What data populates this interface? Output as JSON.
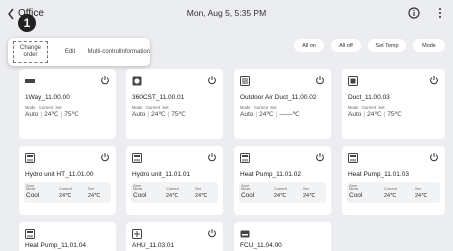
{
  "header": {
    "title": "Office",
    "datetime": "Mon, Aug 5, 5:35 PM",
    "badge": "1"
  },
  "menu": {
    "change_order": "Change order",
    "edit": "Edit",
    "multi_control": "Multi-control",
    "information": "Information"
  },
  "actions": {
    "all_on": "All on",
    "all_off": "All off",
    "set_temp": "Set Temp",
    "mode": "Mode"
  },
  "labels": {
    "mode": "Mode",
    "current": "Current",
    "set": "Set",
    "zone": "Zone"
  },
  "devices": [
    {
      "name": "1Way_11.00.00",
      "icon": "ceiling-cassette-1way-icon",
      "mode": "Auto",
      "current": "24℃",
      "set": "75℃"
    },
    {
      "name": "360CST_11.00.01",
      "icon": "360-cassette-icon",
      "mode": "Auto",
      "current": "24℃",
      "set": "75℃"
    },
    {
      "name": "Outdoor Air Duct_11.00.02",
      "icon": "outdoor-air-duct-icon",
      "mode": "Auto",
      "current": "24℃",
      "set": "——℃"
    },
    {
      "name": "Duct_11.00.03",
      "icon": "duct-icon",
      "mode": "Auto",
      "current": "24℃",
      "set": "75℃"
    },
    {
      "name": "Hydro unit HT_11.01.00",
      "icon": "hydro-unit-icon",
      "mode": "Cool",
      "current": "24℃",
      "set": "24℃"
    },
    {
      "name": "Hydro unit_11.01.01",
      "icon": "hydro-unit-icon",
      "mode": "Cool",
      "current": "24℃",
      "set": "24℃"
    },
    {
      "name": "Heat Pump_11.01.02",
      "icon": "heat-pump-icon",
      "mode": "Cool",
      "current": "24℃",
      "set": "24℃"
    },
    {
      "name": "Heat Pump_11.01.03",
      "icon": "heat-pump-icon",
      "mode": "Cool",
      "current": "24℃",
      "set": "24℃"
    },
    {
      "name": "Heat Pump_11.01.04",
      "icon": "heat-pump-icon"
    },
    {
      "name": "AHU_11.03.01",
      "icon": "ahu-icon"
    },
    {
      "name": "FCU_11.04.00",
      "icon": "fcu-icon"
    }
  ]
}
